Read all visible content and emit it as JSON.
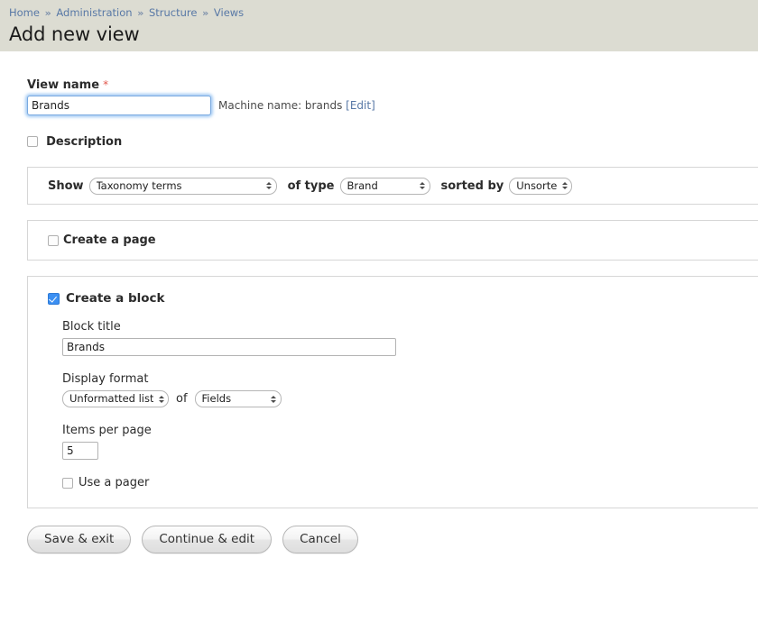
{
  "header": {
    "breadcrumb": [
      {
        "label": "Home"
      },
      {
        "label": "Administration"
      },
      {
        "label": "Structure"
      },
      {
        "label": "Views"
      }
    ],
    "separator": "»",
    "title": "Add new view"
  },
  "form": {
    "view_name": {
      "label": "View name",
      "required_mark": "*",
      "value": "Brands",
      "placeholder": ""
    },
    "machine_name": {
      "prefix": "Machine name: brands",
      "edit_label": "[Edit]"
    },
    "description": {
      "label": "Description",
      "checked": false
    },
    "show": {
      "show_label": "Show",
      "show_value": "Taxonomy terms",
      "of_type_label": "of type",
      "of_type_value": "Brand",
      "sorted_by_label": "sorted by",
      "sorted_by_value": "Unsorted"
    },
    "create_page": {
      "label": "Create a page",
      "checked": false
    },
    "create_block": {
      "label": "Create a block",
      "checked": true,
      "block_title": {
        "label": "Block title",
        "value": "Brands"
      },
      "display_format": {
        "label": "Display format",
        "format_value": "Unformatted list",
        "of_label": "of",
        "of_value": "Fields"
      },
      "items_per_page": {
        "label": "Items per page",
        "value": "5"
      },
      "use_pager": {
        "label": "Use a pager",
        "checked": false
      }
    },
    "actions": {
      "save_exit": "Save & exit",
      "continue_edit": "Continue & edit",
      "cancel": "Cancel"
    }
  },
  "colors": {
    "header_band": "#dcdcd2",
    "link": "#5878a6",
    "required": "#e2584d",
    "checkbox_accent": "#3b8ff2",
    "focus_ring": "#5aa0eb"
  }
}
